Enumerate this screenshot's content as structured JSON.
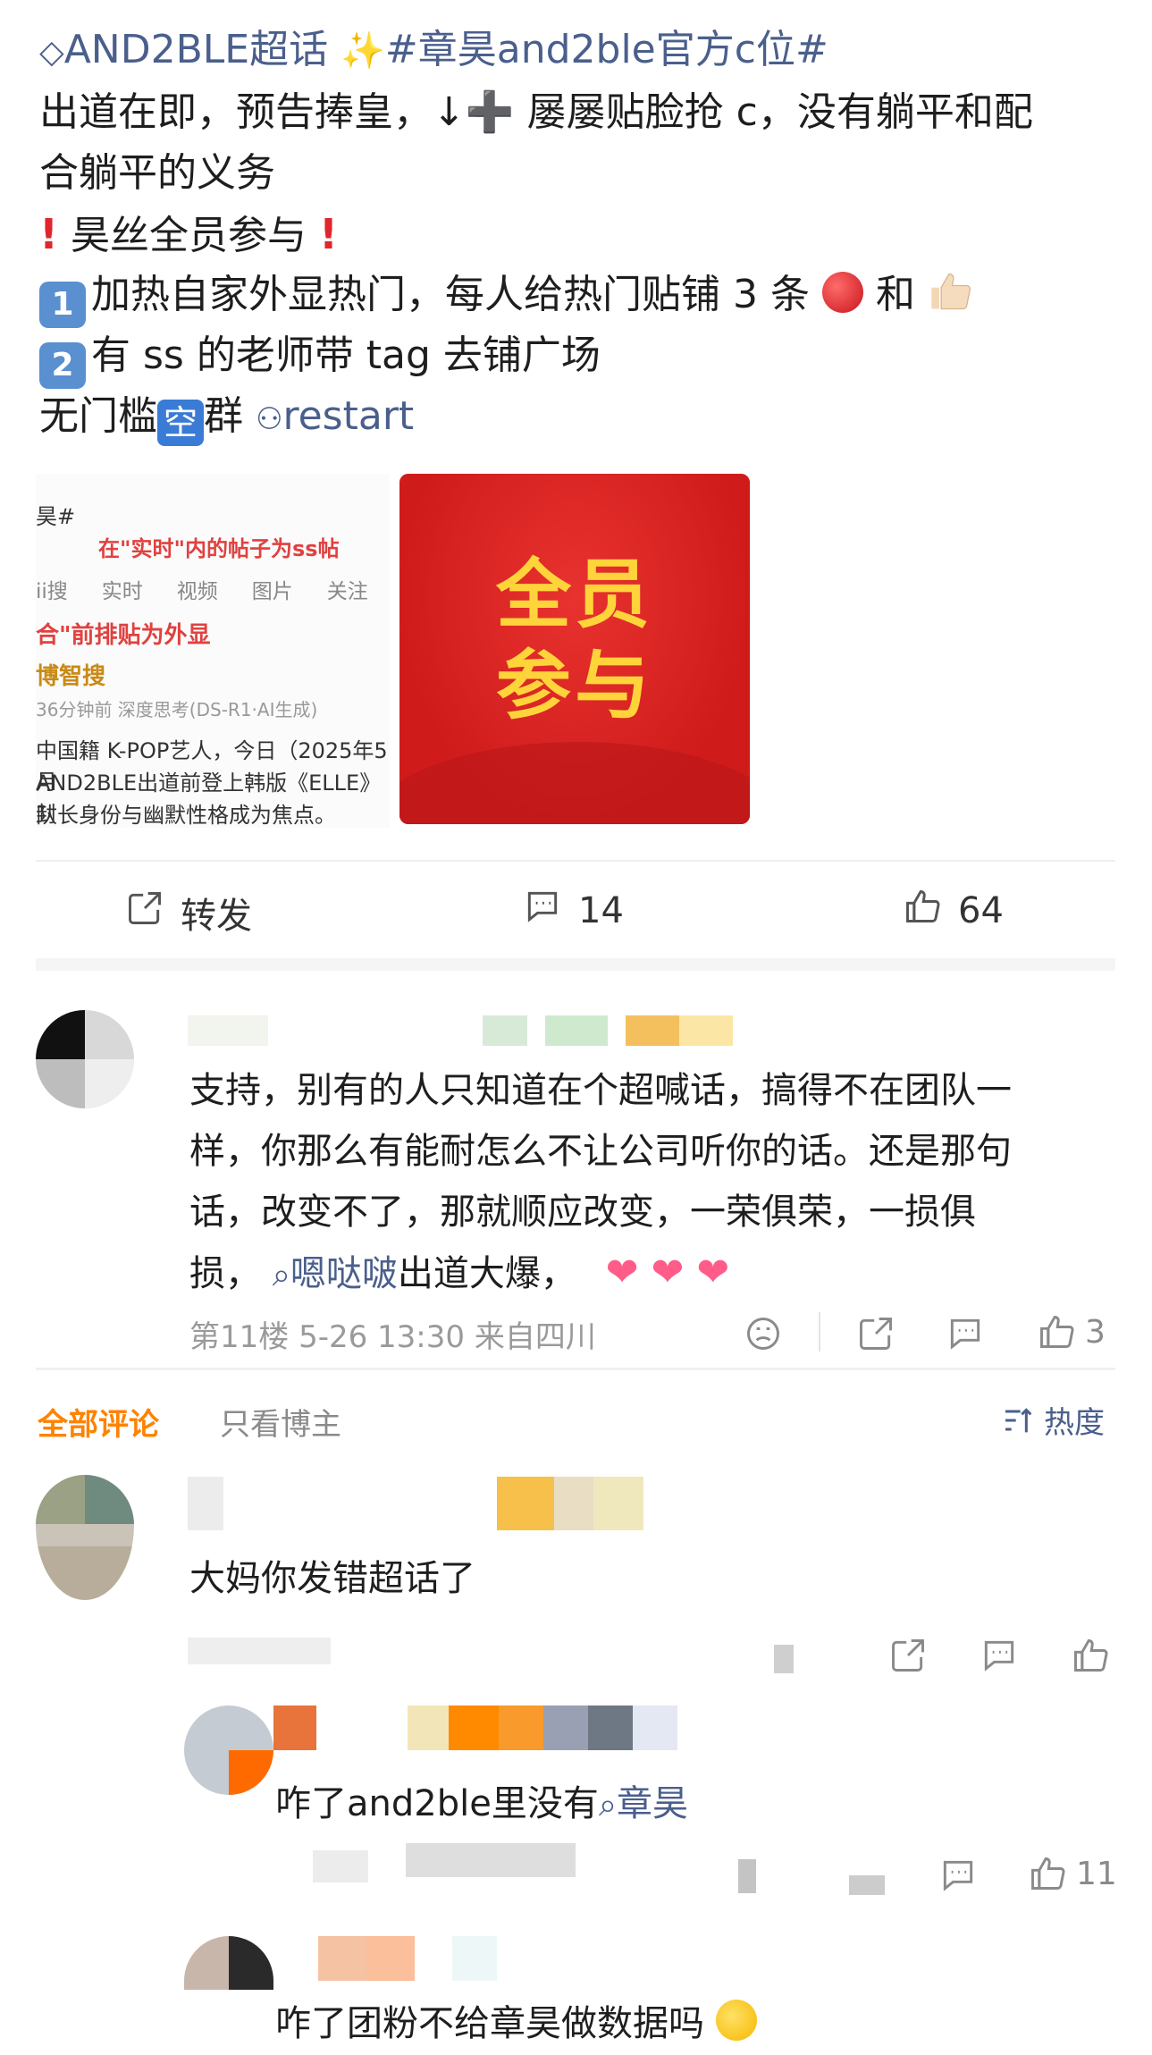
{
  "post": {
    "topic_prefix": "AND2BLE超话",
    "topic_tag": "#章昊and2ble官方c位#",
    "line1": "出道在即，预告捧皇，↓➕ 屡屡贴脸抢 c，没有躺平和配",
    "line2": "合躺平的义务",
    "rally": "昊丝全员参与",
    "item1_num": "1",
    "item1_text": "加热自家外显热门，每人给热门贴铺 3 条",
    "item1_and": "和",
    "item2_num": "2",
    "item2_text": "有 ss 的老师带 tag 去铺广场",
    "group_prefix": "无门槛",
    "group_badge": "空",
    "group_suffix": "群",
    "group_link": "restart"
  },
  "images": {
    "screenshot": {
      "tab_hash": "昊#",
      "caption": "在\"实时\"内的帖子为ss帖",
      "tabs": [
        "ii搜",
        "实时",
        "视频",
        "图片",
        "关注"
      ],
      "note": "合\"前排贴为外显",
      "brand": "博智搜",
      "time_info": "36分钟前  深度思考(DS-R1·AI生成)",
      "body1": "中国籍 K-POP艺人，今日（2025年5月",
      "body2": "AND2BLE出道前登上韩版《ELLE》封",
      "body3": "队长身份与幽默性格成为焦点。"
    },
    "poster": {
      "line1": "全员",
      "line2": "参与"
    }
  },
  "actions": {
    "repost_label": "转发",
    "comment_count": "14",
    "like_count": "64"
  },
  "featured_comment": {
    "line1": "支持，别有的人只知道在个超喊话，搞得不在团队一",
    "line2": "样，你那么有能耐怎么不让公司听你的话。还是那句",
    "line3": "话，改变不了，那就顺应改变，一荣俱荣，一损俱",
    "line4_pre": "损，",
    "line4_link": "嗯哒啵",
    "line4_post": "出道大爆，",
    "meta": "第11楼  5-26 13:30  来自四川",
    "likes": "3"
  },
  "tabs": {
    "all": "全部评论",
    "host": "只看博主",
    "sort": "热度"
  },
  "comments": [
    {
      "text": "大妈你发错超话了"
    },
    {
      "text_pre": "咋了and2ble里没有",
      "link": "章昊"
    },
    {
      "likes": "11"
    },
    {
      "text": "咋了团粉不给章昊做数据吗"
    }
  ],
  "colors": {
    "link": "#4a5f8c",
    "accent_orange": "#ff8200",
    "poster_red": "#d9211f",
    "poster_yellow": "#ffd43b"
  }
}
